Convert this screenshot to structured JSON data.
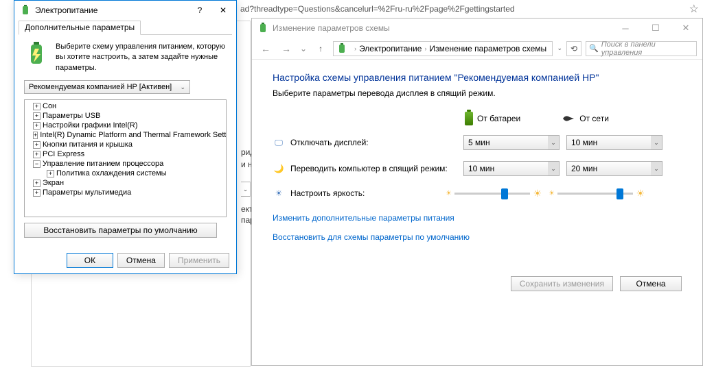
{
  "browser": {
    "url_fragment": "ad?threadtype=Questions&cancelurl=%2Fru-ru%2Fpage%2Fgettingstarted"
  },
  "ctrlwin": {
    "title": "Изменение параметров схемы",
    "breadcrumb1": "Электропитание",
    "breadcrumb2": "Изменение параметров схемы",
    "search_placeholder": "Поиск в панели управления",
    "heading": "Настройка схемы управления питанием \"Рекомендуемая компанией HP\"",
    "subtitle": "Выберите параметры перевода дисплея в спящий режим.",
    "col_battery": "От батареи",
    "col_ac": "От сети",
    "lbl_display": "Отключать дисплей:",
    "lbl_sleep": "Переводить компьютер в спящий режим:",
    "lbl_brightness": "Настроить яркость:",
    "disp_batt": "5 мин",
    "disp_ac": "10 мин",
    "sleep_batt": "10 мин",
    "sleep_ac": "20 мин",
    "link_advanced": "Изменить дополнительные параметры питания",
    "link_restore": "Восстановить для схемы параметры по умолчанию",
    "btn_save": "Сохранить изменения",
    "btn_cancel": "Отмена"
  },
  "dlg": {
    "title": "Электропитание",
    "tab": "Дополнительные параметры",
    "intro": "Выберите схему управления питанием, которую вы хотите настроить, а затем задайте нужные параметры.",
    "scheme": "Рекомендуемая компанией HP [Активен]",
    "tree": [
      {
        "lvl": 1,
        "tog": "+",
        "label": "Сон"
      },
      {
        "lvl": 1,
        "tog": "+",
        "label": "Параметры USB"
      },
      {
        "lvl": 1,
        "tog": "+",
        "label": "Настройки графики Intel(R)"
      },
      {
        "lvl": 1,
        "tog": "+",
        "label": "Intel(R) Dynamic Platform and Thermal Framework Settings"
      },
      {
        "lvl": 1,
        "tog": "+",
        "label": "Кнопки питания и крышка"
      },
      {
        "lvl": 1,
        "tog": "+",
        "label": "PCI Express"
      },
      {
        "lvl": 1,
        "tog": "−",
        "label": "Управление питанием процессора"
      },
      {
        "lvl": 2,
        "tog": "+",
        "label": "Политика охлаждения системы"
      },
      {
        "lvl": 1,
        "tog": "+",
        "label": "Экран"
      },
      {
        "lvl": 1,
        "tog": "+",
        "label": "Параметры мультимедиа"
      }
    ],
    "restore": "Восстановить параметры по умолчанию",
    "ok": "ОК",
    "cancel": "Отмена",
    "apply": "Применить"
  },
  "bg": {
    "t1": "рид",
    "t2": "и но",
    "t3": "ект",
    "t4": "пар"
  }
}
